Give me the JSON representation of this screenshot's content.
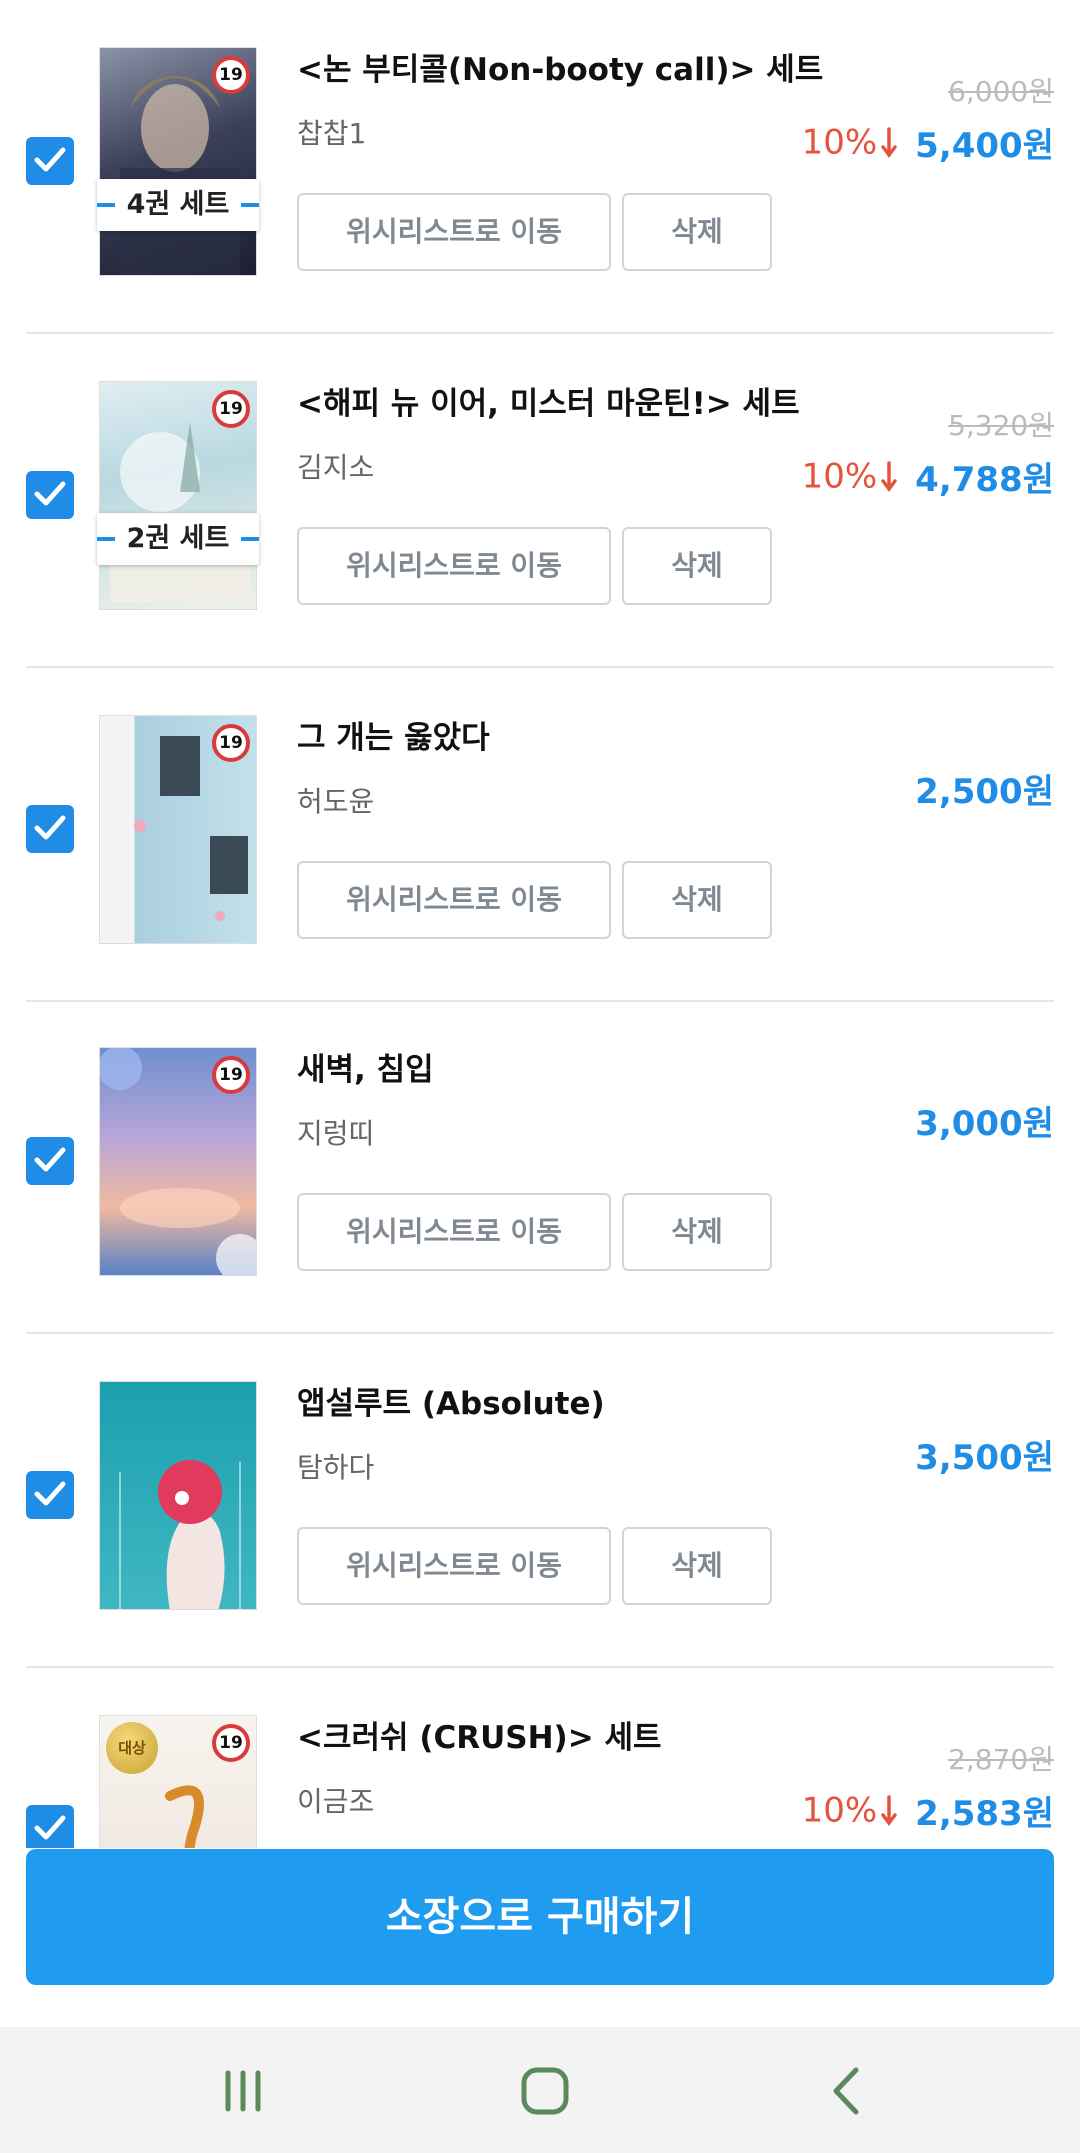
{
  "items": [
    {
      "title": "<논 부티콜(Non-booty call)> 세트",
      "author": "찹찹1",
      "set_badge": "4권 세트",
      "original_price": "6,000원",
      "discount": "10%",
      "price": "5,400원",
      "checked": true,
      "wishlist_label": "위시리스트로 이동",
      "delete_label": "삭제",
      "age_rating": "19"
    },
    {
      "title": "<해피 뉴 이어, 미스터 마운틴!> 세트",
      "author": "김지소",
      "set_badge": "2권 세트",
      "original_price": "5,320원",
      "discount": "10%",
      "price": "4,788원",
      "checked": true,
      "wishlist_label": "위시리스트로 이동",
      "delete_label": "삭제",
      "age_rating": "19"
    },
    {
      "title": "그 개는 옳았다",
      "author": "허도윤",
      "price": "2,500원",
      "checked": true,
      "wishlist_label": "위시리스트로 이동",
      "delete_label": "삭제",
      "age_rating": "19"
    },
    {
      "title": "새벽, 침입",
      "author": "지렁띠",
      "price": "3,000원",
      "checked": true,
      "wishlist_label": "위시리스트로 이동",
      "delete_label": "삭제",
      "age_rating": "19"
    },
    {
      "title": "앱설루트 (Absolute)",
      "author": "탐하다",
      "price": "3,500원",
      "checked": true,
      "wishlist_label": "위시리스트로 이동",
      "delete_label": "삭제"
    },
    {
      "title": "<크러쉬 (CRUSH)> 세트",
      "author": "이금조",
      "original_price": "2,870원",
      "discount": "10%",
      "price": "2,583원",
      "checked": true,
      "age_rating": "19",
      "award_label": "대상"
    }
  ],
  "buy_button_label": "소장으로 구매하기",
  "colors": {
    "accent": "#1f8ce6",
    "buy_button": "#1f9bf0",
    "discount": "#e5533d",
    "nav_icons": "#5a8a5c"
  },
  "navbar": {
    "recents_icon": "recents-icon",
    "home_icon": "home-icon",
    "back_icon": "back-icon"
  }
}
